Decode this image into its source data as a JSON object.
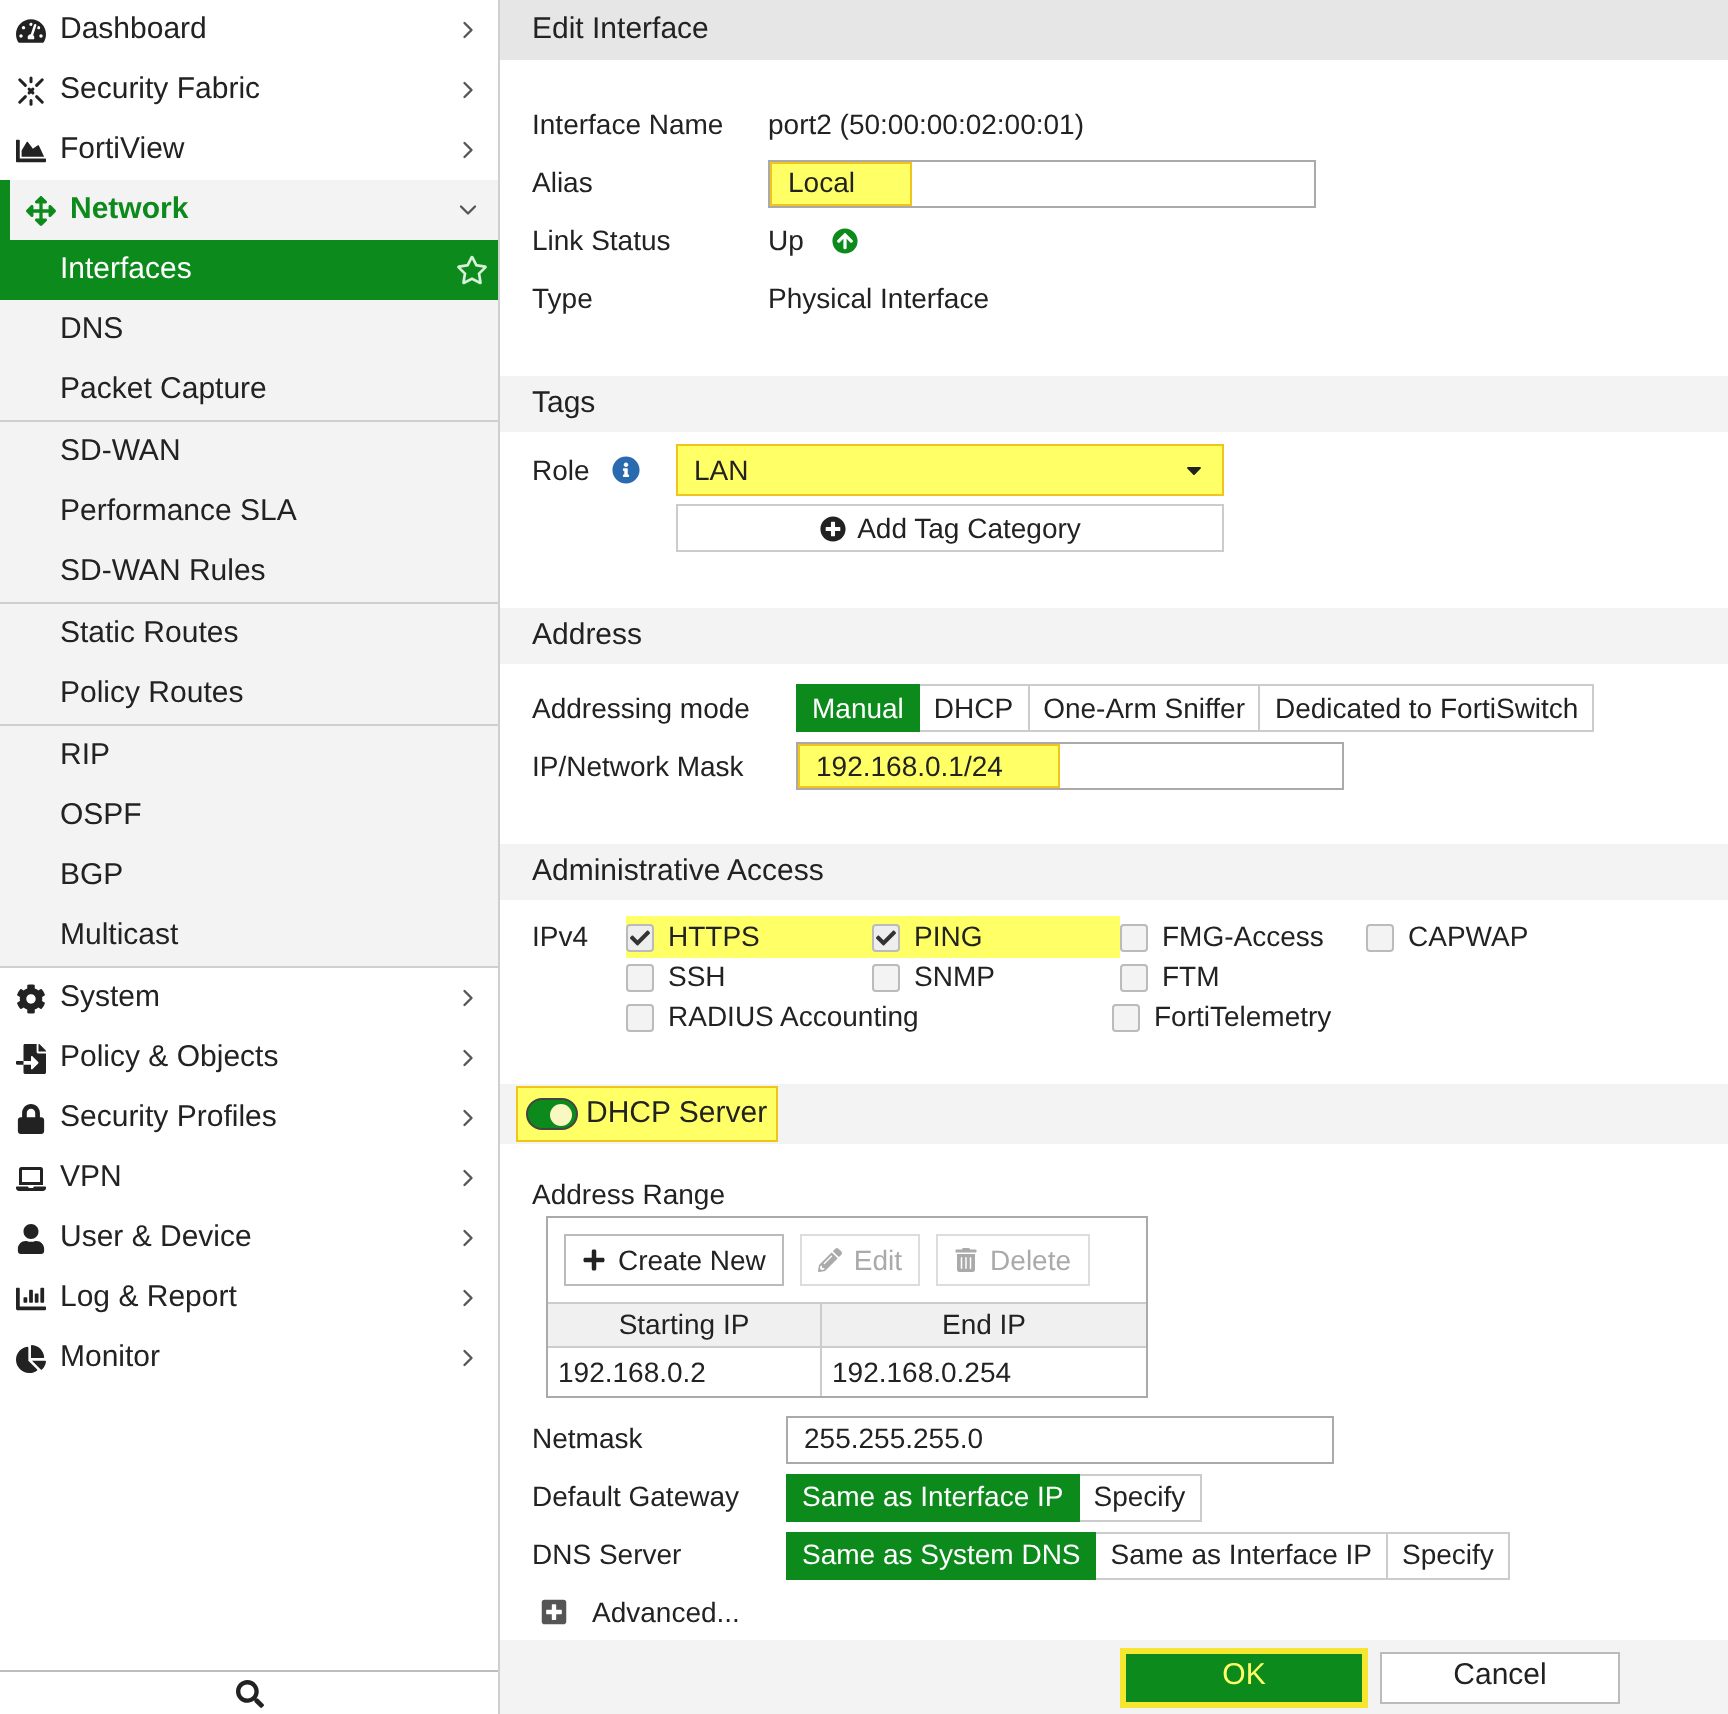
{
  "sidebar": {
    "items": [
      {
        "label": "Dashboard",
        "expanded": false
      },
      {
        "label": "Security Fabric",
        "expanded": false
      },
      {
        "label": "FortiView",
        "expanded": false
      },
      {
        "label": "Network",
        "expanded": true,
        "groups": [
          [
            {
              "label": "Interfaces",
              "selected": true
            },
            {
              "label": "DNS",
              "selected": false
            },
            {
              "label": "Packet Capture",
              "selected": false
            }
          ],
          [
            {
              "label": "SD-WAN",
              "selected": false
            },
            {
              "label": "Performance SLA",
              "selected": false
            },
            {
              "label": "SD-WAN Rules",
              "selected": false
            }
          ],
          [
            {
              "label": "Static Routes",
              "selected": false
            },
            {
              "label": "Policy Routes",
              "selected": false
            }
          ],
          [
            {
              "label": "RIP",
              "selected": false
            },
            {
              "label": "OSPF",
              "selected": false
            },
            {
              "label": "BGP",
              "selected": false
            },
            {
              "label": "Multicast",
              "selected": false
            }
          ]
        ]
      },
      {
        "label": "System",
        "expanded": false
      },
      {
        "label": "Policy & Objects",
        "expanded": false
      },
      {
        "label": "Security Profiles",
        "expanded": false
      },
      {
        "label": "VPN",
        "expanded": false
      },
      {
        "label": "User & Device",
        "expanded": false
      },
      {
        "label": "Log & Report",
        "expanded": false
      },
      {
        "label": "Monitor",
        "expanded": false
      }
    ]
  },
  "title": "Edit Interface",
  "interface": {
    "name_label": "Interface Name",
    "name": "port2 (50:00:00:02:00:01)",
    "alias_label": "Alias",
    "alias": {
      "value": "Local",
      "highlighted": true
    },
    "link_label": "Link Status",
    "link": "Up",
    "type_label": "Type",
    "type": "Physical Interface"
  },
  "tags": {
    "header": "Tags",
    "role_label": "Role",
    "role": {
      "value": "LAN",
      "highlighted": true
    },
    "add_button": "Add Tag Category"
  },
  "address": {
    "header": "Address",
    "mode_label": "Addressing mode",
    "modes": [
      {
        "label": "Manual",
        "selected": true
      },
      {
        "label": "DHCP",
        "selected": false
      },
      {
        "label": "One-Arm Sniffer",
        "selected": false
      },
      {
        "label": "Dedicated to FortiSwitch",
        "selected": false
      }
    ],
    "ip_label": "IP/Network Mask",
    "ip": {
      "value": "192.168.0.1/24",
      "highlighted": true
    }
  },
  "access": {
    "header": "Administrative Access",
    "label": "IPv4",
    "rows": [
      [
        {
          "label": "HTTPS",
          "checked": true,
          "highlighted": true
        },
        {
          "label": "PING",
          "checked": true,
          "highlighted": true
        },
        {
          "label": "FMG-Access",
          "checked": false,
          "highlighted": false
        },
        {
          "label": "CAPWAP",
          "checked": false,
          "highlighted": false
        }
      ],
      [
        {
          "label": "SSH",
          "checked": false,
          "highlighted": false
        },
        {
          "label": "SNMP",
          "checked": false,
          "highlighted": false
        },
        {
          "label": "FTM",
          "checked": false,
          "highlighted": false
        }
      ],
      [
        {
          "label": "RADIUS Accounting",
          "checked": false,
          "highlighted": false
        },
        "",
        {
          "label": "FortiTelemetry",
          "checked": false,
          "highlighted": false
        }
      ]
    ]
  },
  "dhcp": {
    "label": "DHCP Server",
    "on": true,
    "highlighted": true,
    "range_label": "Address Range",
    "toolbar": [
      {
        "label": "Create New",
        "disabled": false
      },
      {
        "label": "Edit",
        "disabled": true
      },
      {
        "label": "Delete",
        "disabled": true
      }
    ],
    "columns": [
      "Starting IP",
      "End IP"
    ],
    "rows": [
      [
        "192.168.0.2",
        "192.168.0.254"
      ]
    ],
    "netmask_label": "Netmask",
    "netmask": "255.255.255.0",
    "gateway_label": "Default Gateway",
    "gateway": [
      {
        "label": "Same as Interface IP",
        "selected": true
      },
      {
        "label": "Specify",
        "selected": false
      }
    ],
    "dns_label": "DNS Server",
    "dns": [
      {
        "label": "Same as System DNS",
        "selected": true
      },
      {
        "label": "Same as Interface IP",
        "selected": false
      },
      {
        "label": "Specify",
        "selected": false
      }
    ],
    "advanced": {
      "label": "Advanced...",
      "expanded": false
    }
  },
  "footer": {
    "ok": {
      "label": "OK",
      "highlighted": true
    },
    "cancel": "Cancel"
  }
}
